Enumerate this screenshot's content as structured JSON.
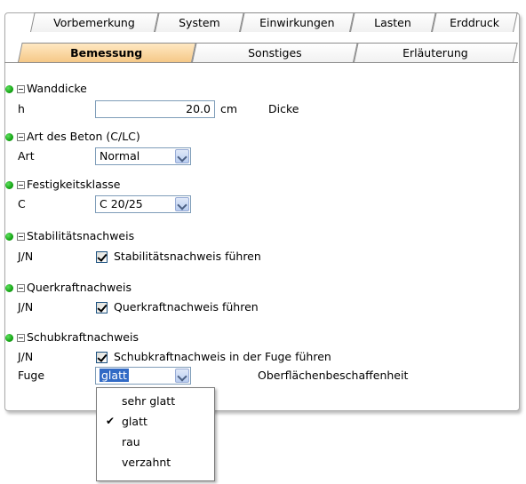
{
  "tabs_row1": [
    {
      "label": "Vorbemerkung"
    },
    {
      "label": "System"
    },
    {
      "label": "Einwirkungen"
    },
    {
      "label": "Lasten"
    },
    {
      "label": "Erddruck"
    }
  ],
  "tabs_row2": [
    {
      "label": "Bemessung",
      "active": true
    },
    {
      "label": "Sonstiges"
    },
    {
      "label": "Erläuterung"
    }
  ],
  "sections": {
    "wanddicke": {
      "title": "Wanddicke",
      "label": "h",
      "value": "20.0",
      "unit": "cm",
      "description": "Dicke"
    },
    "beton": {
      "title": "Art des Beton (C/LC)",
      "label": "Art",
      "value": "Normal"
    },
    "festigkeit": {
      "title": "Festigkeitsklasse",
      "label": "C",
      "value": "C 20/25"
    },
    "stabilitaet": {
      "title": "Stabilitätsnachweis",
      "label": "J/N",
      "checkbox_label": "Stabilitätsnachweis führen",
      "checked": true
    },
    "querkraft": {
      "title": "Querkraftnachweis",
      "label": "J/N",
      "checkbox_label": "Querkraftnachweis führen",
      "checked": true
    },
    "schubkraft": {
      "title": "Schubkraftnachweis",
      "label": "J/N",
      "checkbox_label": "Schubkraftnachweis in der Fuge führen",
      "checked": true,
      "fuge_label": "Fuge",
      "fuge_value": "glatt",
      "fuge_description": "Oberflächenbeschaffenheit"
    }
  },
  "dropdown": {
    "options": [
      "sehr glatt",
      "glatt",
      "rau",
      "verzahnt"
    ],
    "selected": "glatt",
    "tick": "✔"
  },
  "colors": {
    "active_tab": "#f5c887",
    "status_dot": "#16a516",
    "selection": "#316ac5"
  }
}
